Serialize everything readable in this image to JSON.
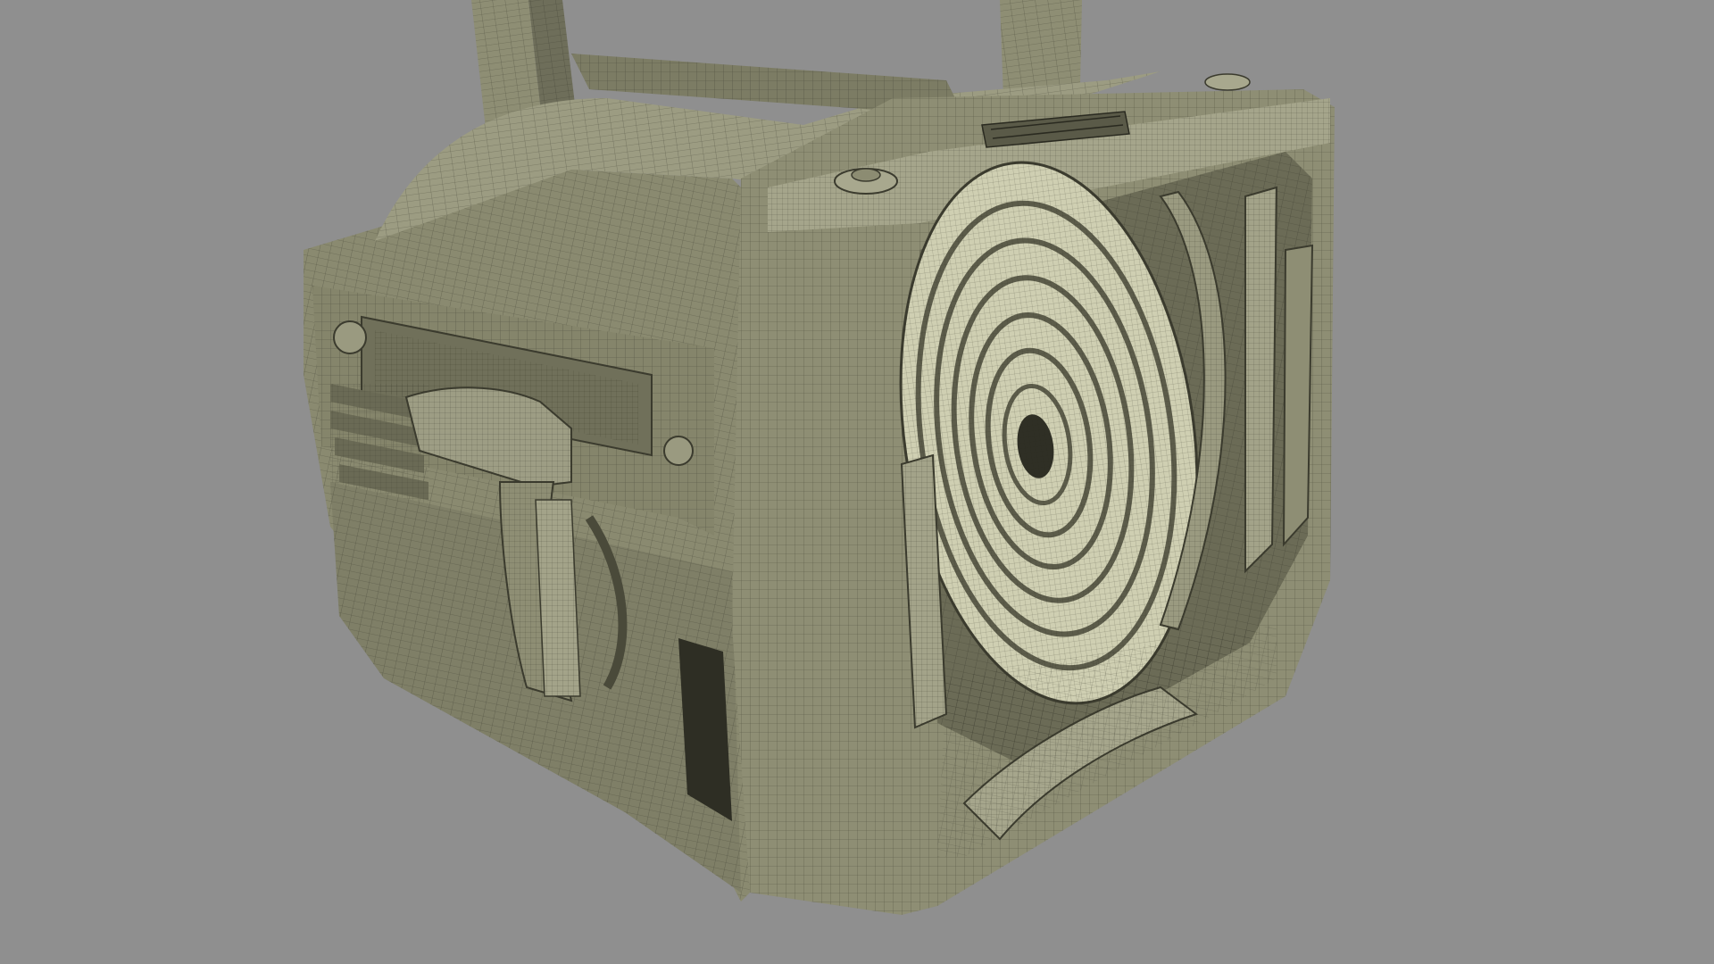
{
  "scene": {
    "subject": "fresnel-spotlight-wireframe-model",
    "colors": {
      "background": "#8f8f8f",
      "surface": "#8e8e74",
      "surface_light": "#b9b99c",
      "surface_dark": "#5f5f4c",
      "lens": "#d2d2b4",
      "lens_dark": "#7a7a62",
      "wire": "#2a2a20"
    }
  }
}
